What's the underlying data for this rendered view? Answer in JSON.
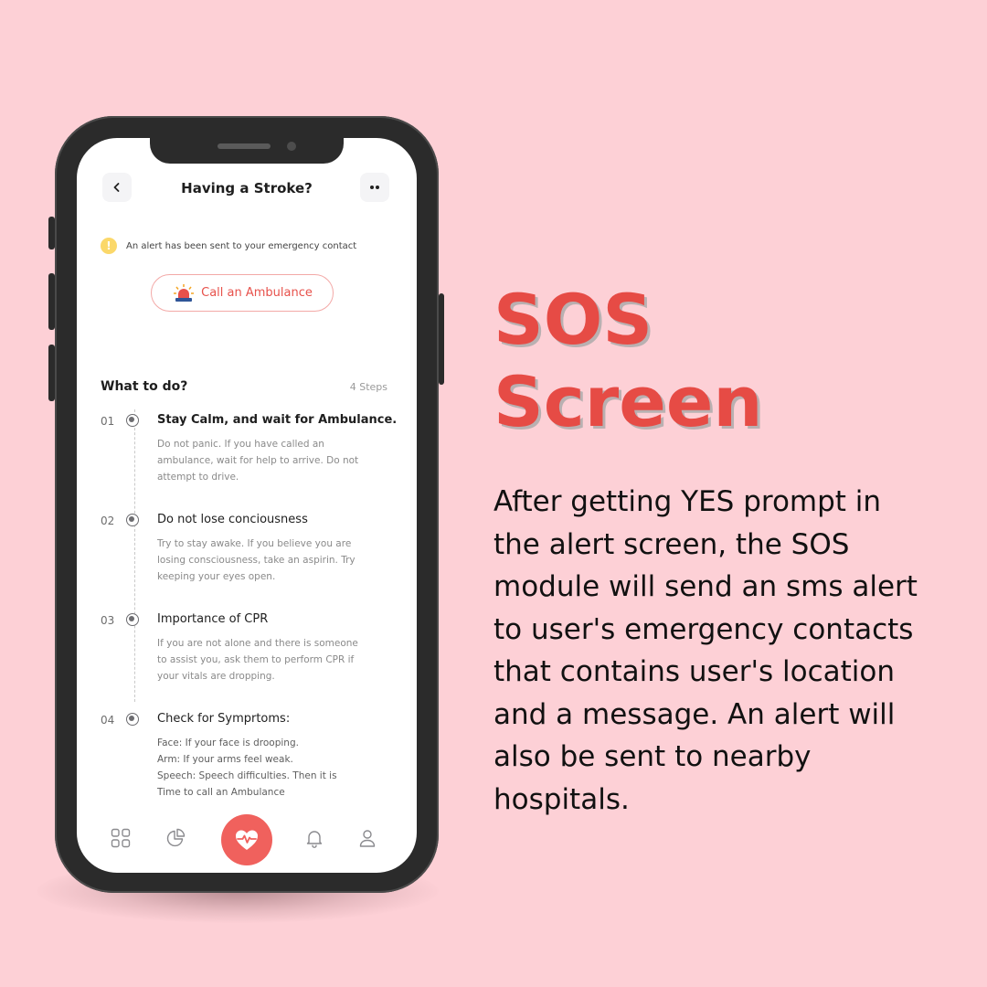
{
  "banner": {
    "heading_line1": "SOS",
    "heading_line2": "Screen",
    "description": "After getting YES prompt in the alert screen, the SOS module will send an sms alert to user's emergency contacts that contains user's location and a message. An alert will also be sent to nearby hospitals."
  },
  "app": {
    "title": "Having a Stroke?",
    "alert": {
      "icon": "!",
      "text": "An alert has been sent to your emergency contact"
    },
    "ambulance_button": {
      "label": "Call an Ambulance"
    },
    "section": {
      "title": "What to do?",
      "count": "4 Steps"
    },
    "steps": [
      {
        "number": "01",
        "title": "Stay Calm, and wait for Ambulance.",
        "lines": [
          "Do not panic. If you have called an",
          "ambulance, wait for help to arrive. Do not",
          "attempt to drive."
        ]
      },
      {
        "number": "02",
        "title": "Do not lose conciousness",
        "lines": [
          "Try to stay awake. If you believe you are",
          "losing consciousness, take an aspirin. Try",
          "keeping your eyes open."
        ]
      },
      {
        "number": "03",
        "title": "Importance of CPR",
        "lines": [
          "If you are not alone and there is someone",
          "to assist you, ask them to perform CPR if",
          "your vitals are dropping."
        ]
      },
      {
        "number": "04",
        "title": "Check for Symprtoms:",
        "lines": [
          "Face: If your face is drooping.",
          "Arm: If your arms feel weak.",
          "Speech: Speech difficulties. Then it is",
          "Time to call an Ambulance"
        ]
      }
    ],
    "nav": [
      "grid-icon",
      "pie-chart-icon",
      "heart-pulse-icon",
      "bell-icon",
      "user-icon"
    ]
  },
  "colors": {
    "background": "#fdd0d6",
    "accent": "#e64b45",
    "nav_active": "#f0615d",
    "alert_yellow": "#fbd86a"
  }
}
